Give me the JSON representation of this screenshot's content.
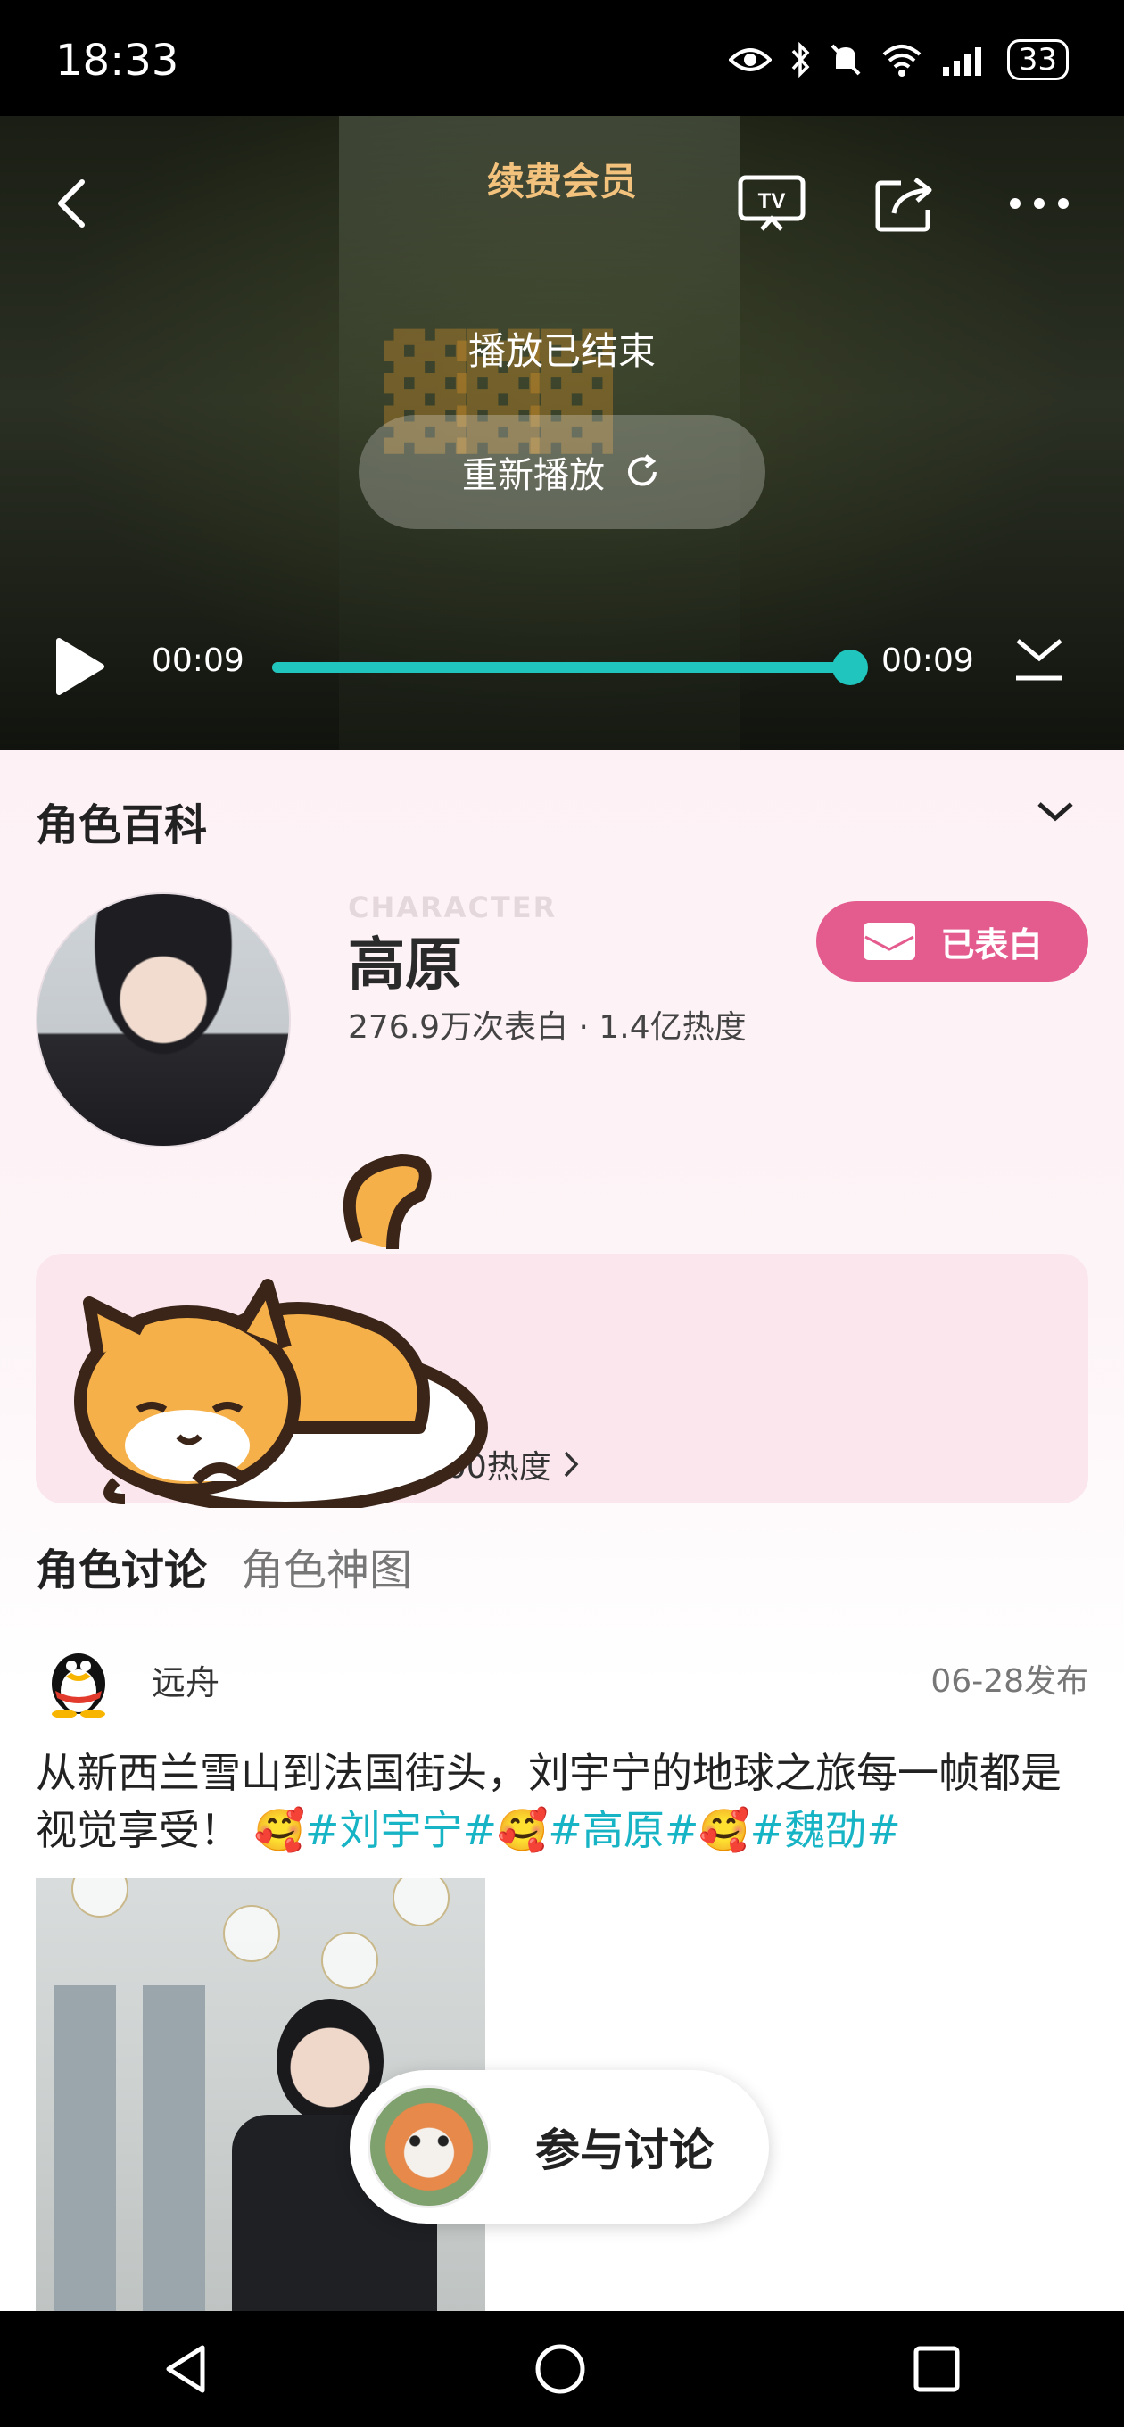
{
  "status_bar": {
    "time": "18:33",
    "battery": "33"
  },
  "player": {
    "renew_label": "续费会员",
    "ended_text": "播放已结束",
    "replay_label": "重新播放",
    "current_time": "00:09",
    "total_time": "00:09",
    "progress": 1.0,
    "accent_color": "#20c6be"
  },
  "wiki": {
    "section_title": "角色百科",
    "watermark": "CHARACTER",
    "name": "高原",
    "confessions": "276.9万次表白",
    "heat": "1.4亿热度",
    "confessed_label": "已表白",
    "activity_text": "白96次 · 增加7700热度"
  },
  "tabs": {
    "discussion": "角色讨论",
    "gallery": "角色神图"
  },
  "post": {
    "author": "远舟",
    "date": "06-28发布",
    "text": "从新西兰雪山到法国街头，刘宇宁的地球之旅每一帧都是视觉享受！",
    "hashtags": [
      "#刘宇宁#",
      "#高原#",
      "#魏劭#"
    ]
  },
  "join_label": "参与讨论",
  "icons": {
    "back": "back-icon",
    "tv": "tv-cast-icon",
    "share": "share-icon",
    "more": "more-icon",
    "replay": "refresh-icon",
    "play": "play-icon",
    "collapse": "collapse-icon",
    "chevron": "chevron-down-icon",
    "envelope": "envelope-icon",
    "nav_back": "nav-back-icon",
    "nav_home": "nav-home-icon",
    "nav_recents": "nav-recents-icon"
  }
}
